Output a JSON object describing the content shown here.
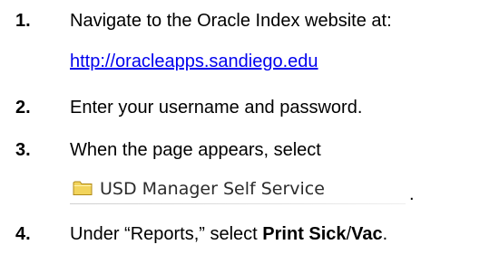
{
  "steps": [
    {
      "number": "1.",
      "text": "Navigate to the Oracle Index website at:",
      "link": "http://oracleapps.sandiego.edu"
    },
    {
      "number": "2.",
      "text": "Enter your username and password."
    },
    {
      "number": "3.",
      "text": "When the page appears, select",
      "menu_item": {
        "icon": "folder-icon",
        "label": "USD Manager Self Service",
        "trailing": "."
      }
    },
    {
      "number": "4.",
      "text_before": "Under “Reports,” select ",
      "bold_part1": "Print Sick",
      "separator": "/",
      "bold_part2": "Vac",
      "text_after": "."
    }
  ],
  "colors": {
    "link": "#0000ee",
    "folder_fill": "#f2d45c",
    "folder_stroke": "#b08a1a"
  }
}
